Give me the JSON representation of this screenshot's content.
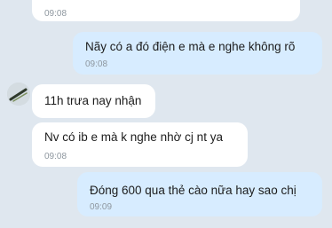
{
  "chat": {
    "messages": [
      {
        "direction": "incoming",
        "text": "...",
        "time": "09:08"
      },
      {
        "direction": "outgoing",
        "text": "Nãy có a đó điện e mà e nghe không rõ",
        "time": "09:08"
      },
      {
        "direction": "incoming",
        "text": "11h trưa nay nhận",
        "time": ""
      },
      {
        "direction": "incoming",
        "text": "Nv có ib e mà k nghe nhờ cj nt ya",
        "time": "09:08"
      },
      {
        "direction": "outgoing",
        "text": "Đóng 600 qua thẻ cào nữa hay sao chị",
        "time": "09:09"
      }
    ]
  },
  "icons": {
    "avatar": "contact-avatar-icon"
  }
}
